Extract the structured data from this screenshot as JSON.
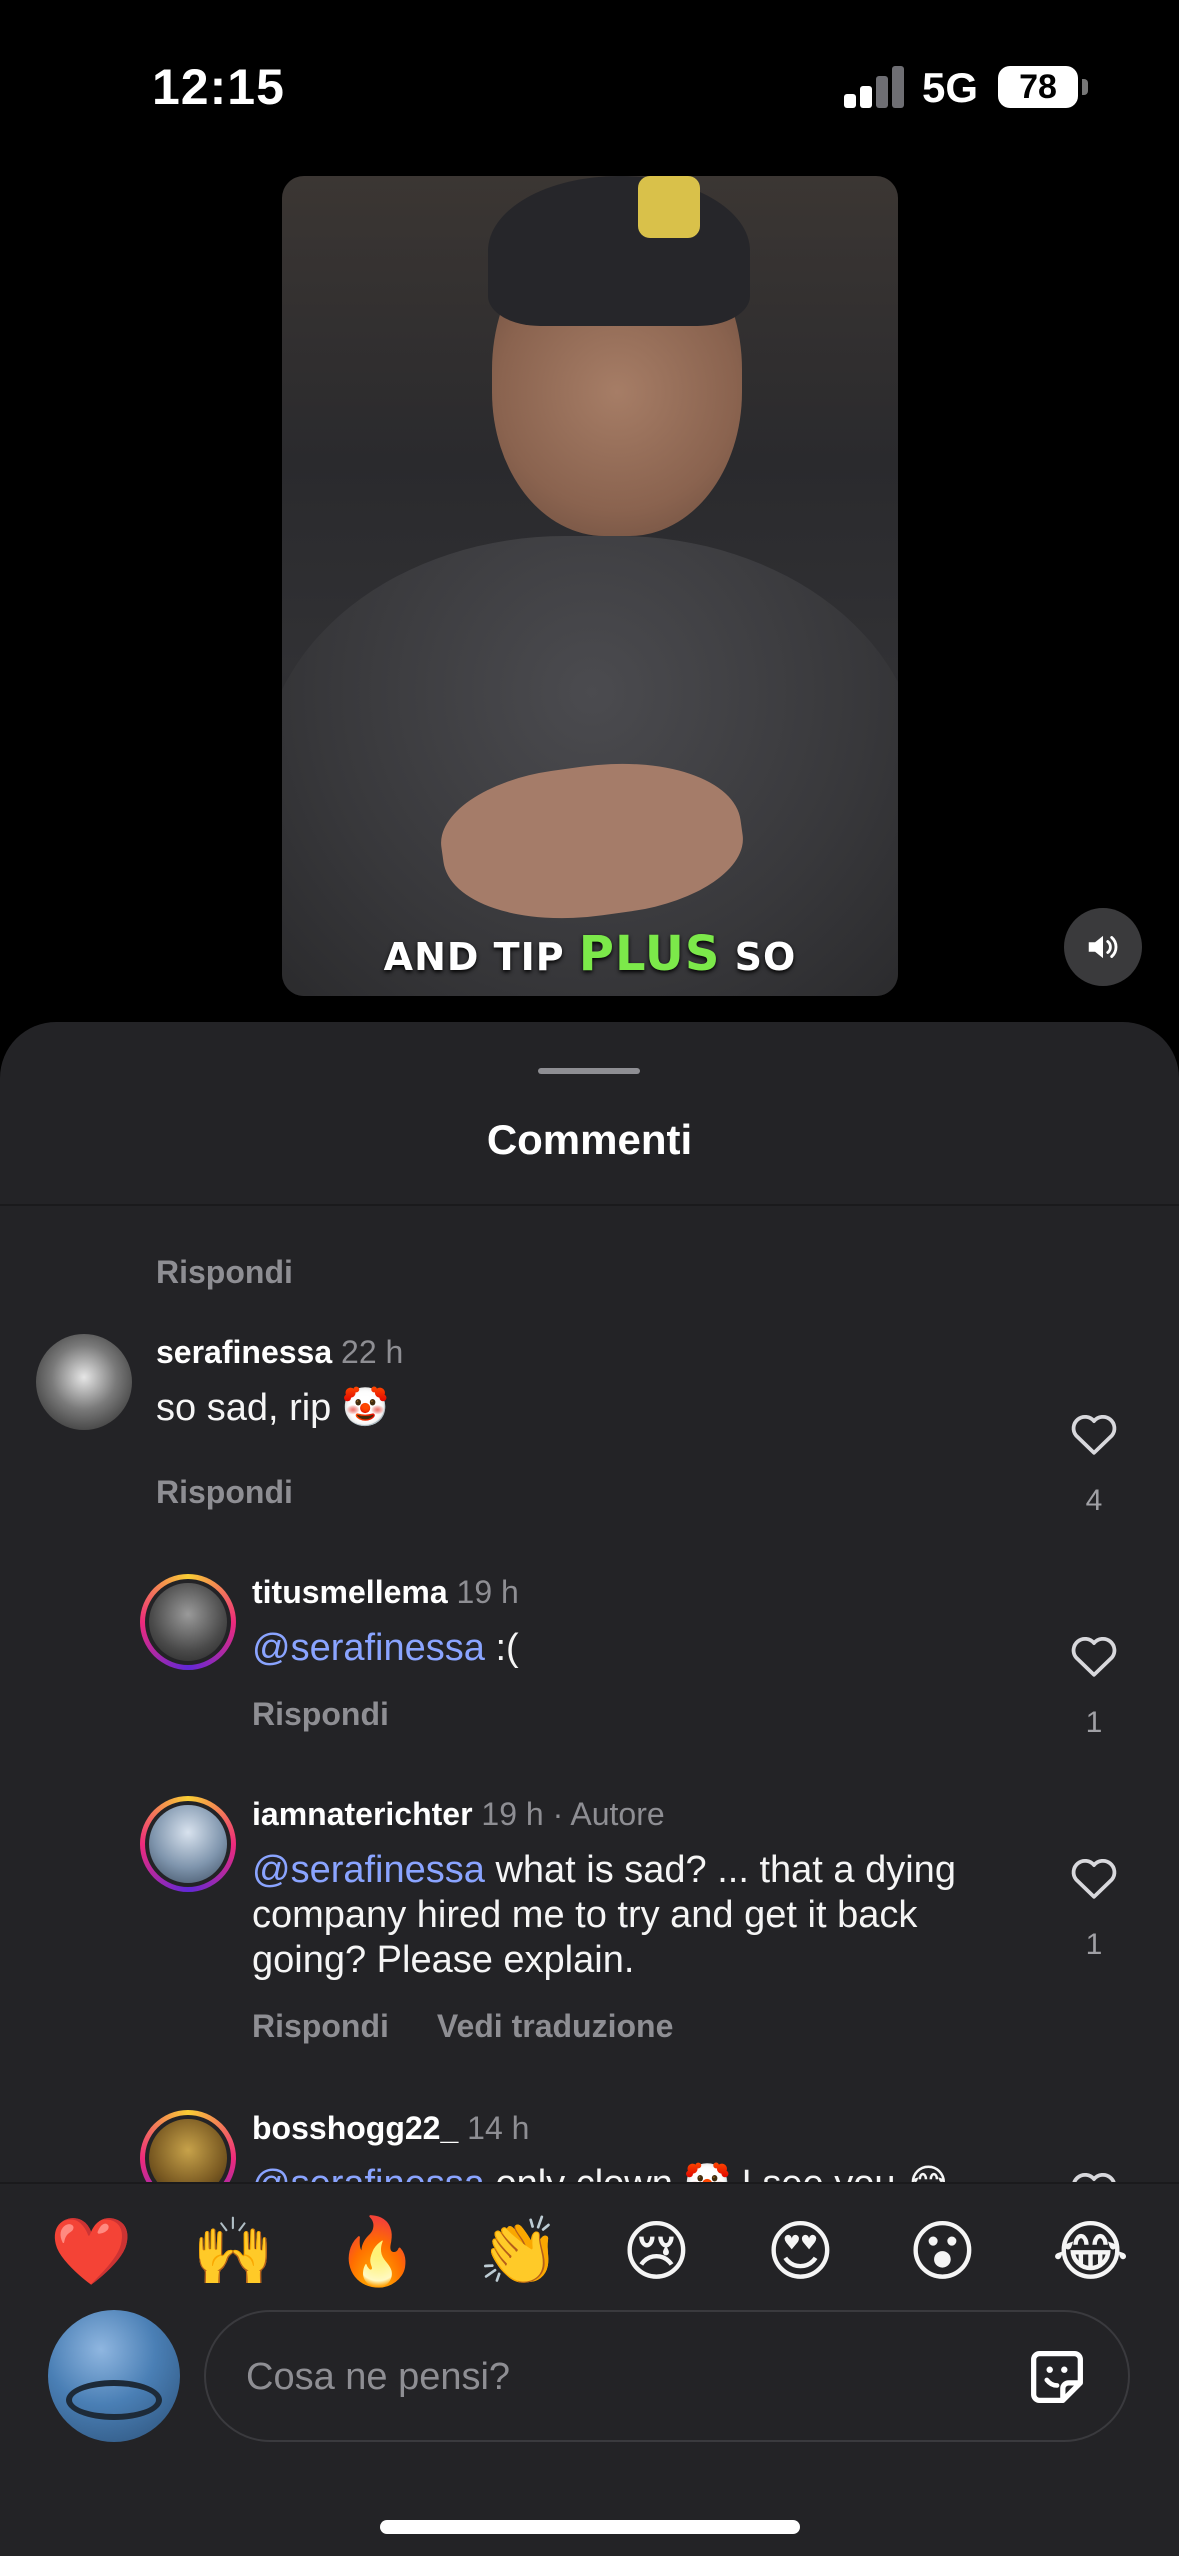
{
  "status_bar": {
    "time": "12:15",
    "network": "5G",
    "battery": "78"
  },
  "video": {
    "caption_pre": "AND TIP ",
    "caption_highlight": "PLUS",
    "caption_post": " SO",
    "highlight_color": "#7ce94a"
  },
  "sheet": {
    "title": "Commenti"
  },
  "partial_reply": "Rispondi",
  "comments": [
    {
      "user": "serafinessa",
      "time": "22 h",
      "text": "so sad, rip 🤡",
      "reply": "Rispondi",
      "likes": "4"
    },
    {
      "user": "titusmellema",
      "time": "19 h",
      "mention": "@serafinessa",
      "text": " :(",
      "reply": "Rispondi",
      "likes": "1"
    },
    {
      "user": "iamnaterichter",
      "time": "19 h · Autore",
      "mention": "@serafinessa",
      "text": " what is sad? ... that a dying company hired me to try and get it back going?  Please explain.",
      "reply": "Rispondi",
      "translate": "Vedi traduzione",
      "likes": "1"
    },
    {
      "user": "bosshogg22_",
      "time": "14 h",
      "mention": "@serafinessa",
      "text": " only clown 🤡 I see you 😂"
    }
  ],
  "emoji_bar": [
    "❤️",
    "🙌",
    "🔥",
    "👏",
    "😢",
    "😍",
    "😮",
    "😂"
  ],
  "composer": {
    "placeholder": "Cosa ne pensi?"
  },
  "colors": {
    "sheet_bg": "#232326",
    "mention": "#8aa4ff",
    "muted": "#8e8e93"
  }
}
